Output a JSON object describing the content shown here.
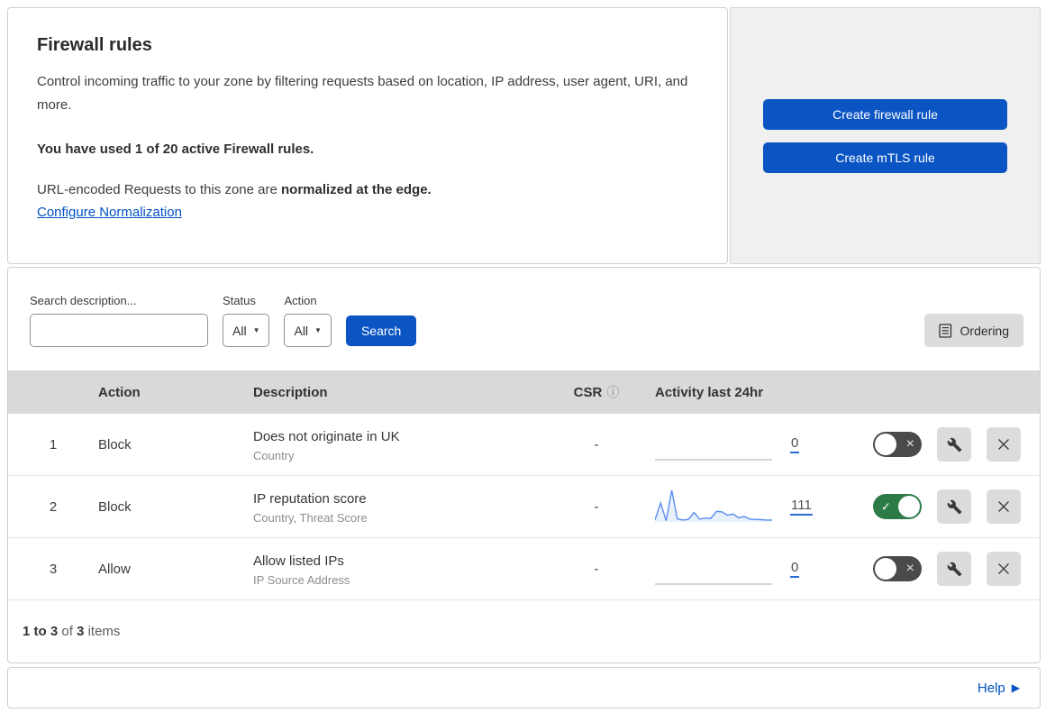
{
  "header": {
    "title": "Firewall rules",
    "description": "Control incoming traffic to your zone by filtering requests based on location, IP address, user agent, URI, and more.",
    "usage": "You have used 1 of 20 active Firewall rules.",
    "normalization_prefix": "URL-encoded Requests to this zone are ",
    "normalization_bold": "normalized at the edge.",
    "normalization_link": "Configure Normalization"
  },
  "actions_panel": {
    "create_firewall_rule": "Create firewall rule",
    "create_mtls_rule": "Create mTLS rule"
  },
  "filters": {
    "search_label": "Search description...",
    "status_label": "Status",
    "status_value": "All",
    "action_label": "Action",
    "action_value": "All",
    "search_button": "Search",
    "ordering_button": "Ordering"
  },
  "table": {
    "columns": {
      "action": "Action",
      "description": "Description",
      "csr": "CSR",
      "activity": "Activity last 24hr"
    },
    "rows": [
      {
        "priority": "1",
        "action": "Block",
        "description": "Does not originate in UK",
        "fields": "Country",
        "csr": "-",
        "count": "0",
        "enabled": false,
        "sparkline": null
      },
      {
        "priority": "2",
        "action": "Block",
        "description": "IP reputation score",
        "fields": "Country, Threat Score",
        "csr": "-",
        "count": "111",
        "enabled": true,
        "sparkline": [
          6,
          60,
          4,
          100,
          10,
          6,
          8,
          30,
          9,
          12,
          11,
          33,
          32,
          21,
          25,
          13,
          17,
          9,
          8,
          7,
          6,
          6
        ]
      },
      {
        "priority": "3",
        "action": "Allow",
        "description": "Allow listed IPs",
        "fields": "IP Source Address",
        "csr": "-",
        "count": "0",
        "enabled": false,
        "sparkline": null
      }
    ],
    "summary": {
      "range": "1 to 3",
      "of": "of",
      "total": "3",
      "items": "items"
    }
  },
  "footer": {
    "help": "Help"
  },
  "colors": {
    "accent_blue": "#0b54c4",
    "link_blue": "#0051c3",
    "toggle_on_green": "#2c7b47",
    "toggle_off_gray": "#4a4a4a",
    "sparkline_blue": "#5b8def",
    "table_header_gray": "#d9d9d9"
  },
  "chart_data": {
    "type": "area",
    "title": "Activity last 24hr (rule 2 sparkline)",
    "x": "hourly buckets over last 24hr",
    "values": [
      6,
      60,
      4,
      100,
      10,
      6,
      8,
      30,
      9,
      12,
      11,
      33,
      32,
      21,
      25,
      13,
      17,
      9,
      8,
      7,
      6,
      6
    ],
    "total": 111,
    "ylim": [
      0,
      100
    ],
    "grid": false,
    "legend": false
  }
}
